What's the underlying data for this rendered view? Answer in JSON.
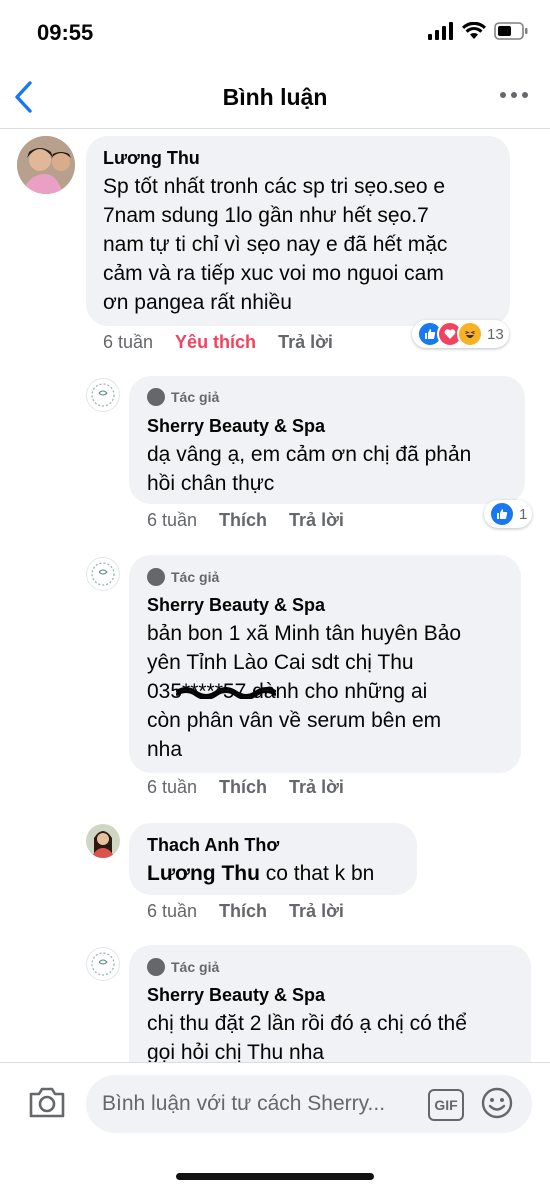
{
  "status": {
    "time": "09:55"
  },
  "nav": {
    "title": "Bình luận"
  },
  "comments": [
    {
      "author": "Lương Thu",
      "lines": [
        "Sp tốt nhất tronh các sp tri sẹo.seo e",
        "7nam sdung 1lo gần như hết sẹo.7",
        "nam tự ti chỉ vì sẹo nay e đã hết mặc",
        "cảm và ra tiếp xuc voi mo nguoi cam",
        "ơn pangea rất nhiều"
      ],
      "time": "6 tuần",
      "like": "Yêu thích",
      "reply": "Trả lời",
      "reaction_count": "13"
    },
    {
      "badge": "Tác giả",
      "author": "Sherry Beauty & Spa",
      "lines": [
        "dạ vâng ạ, em cảm ơn chị đã phản",
        "hồi chân thực"
      ],
      "time": "6 tuần",
      "like": "Thích",
      "reply": "Trả lời",
      "reaction_count": "1"
    },
    {
      "badge": "Tác giả",
      "author": "Sherry Beauty & Spa",
      "lines": [
        "bản bon 1  xã Minh tân huyên Bảo",
        "yên Tỉnh Lào Cai sdt chị Thu",
        "035*****57 dành cho những ai",
        "còn phân vân về serum bên em",
        "nha"
      ],
      "time": "6 tuần",
      "like": "Thích",
      "reply": "Trả lời"
    },
    {
      "author": "Thach Anh Thơ",
      "mention": "Lương Thu",
      "text": " co that k bn",
      "time": "6 tuần",
      "like": "Thích",
      "reply": "Trả lời"
    },
    {
      "badge": "Tác giả",
      "author": "Sherry Beauty & Spa",
      "lines": [
        "chị thu đặt 2 lần rồi đó ạ chị có thể",
        "gọi hỏi chị Thu nha"
      ]
    }
  ],
  "composer": {
    "placeholder": "Bình luận với tư cách Sherry...",
    "gif_label": "GIF"
  },
  "colors": {
    "accent": "#1877f2",
    "love": "#f3425f",
    "bubble": "#f0f2f5",
    "muted": "#65676b"
  }
}
